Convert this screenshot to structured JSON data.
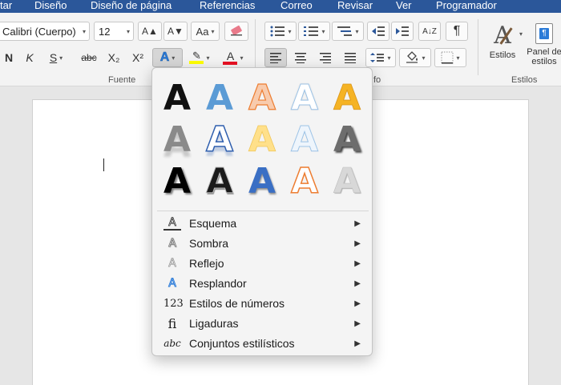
{
  "tabs": [
    "tar",
    "Diseño",
    "Diseño de página",
    "Referencias",
    "Correo",
    "Revisar",
    "Ver",
    "Programador"
  ],
  "font": {
    "name": "Calibri (Cuerpo)",
    "size": "12",
    "grow_icon": "A▲",
    "shrink_icon": "A▼",
    "case_icon": "Aa",
    "clear_icon": "eraser-icon",
    "bold": "N",
    "italic": "K",
    "underline": "S",
    "strike": "abc",
    "subscript": "X₂",
    "superscript": "X²",
    "effects": "A",
    "highlight": "✎",
    "font_color": "A",
    "group_label": "Fuente"
  },
  "paragraph": {
    "group_label": "fo",
    "pilcrow": "¶",
    "sort": "A↓Z"
  },
  "styles": {
    "label": "Estilos",
    "pane_line1": "Panel de",
    "pane_line2": "estilos",
    "group_label": "Estilos"
  },
  "effects_menu": {
    "items": [
      {
        "icon": "A",
        "label": "Esquema"
      },
      {
        "icon": "A",
        "label": "Sombra"
      },
      {
        "icon": "A",
        "label": "Reflejo"
      },
      {
        "icon": "A",
        "label": "Resplandor"
      },
      {
        "icon": "123",
        "label": "Estilos de números"
      },
      {
        "icon": "fi",
        "label": "Ligaduras"
      },
      {
        "icon": "abc",
        "label": "Conjuntos estilísticos"
      }
    ]
  },
  "colors": {
    "accent_blue": "#2b579a",
    "highlight_yellow": "#ffff00",
    "font_red": "#e81123"
  }
}
